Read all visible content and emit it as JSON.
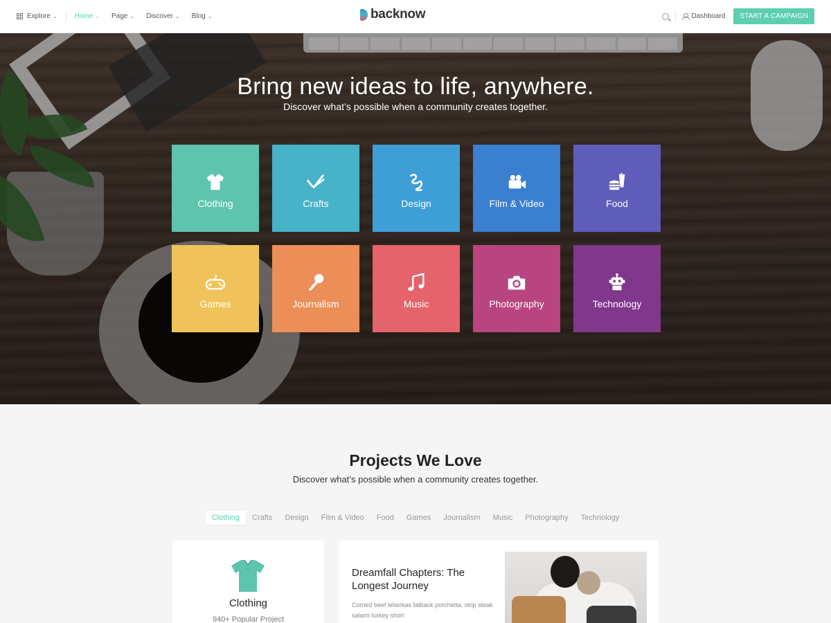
{
  "header": {
    "nav": [
      {
        "label": "Explore",
        "active": false
      },
      {
        "label": "Home",
        "active": true
      },
      {
        "label": "Page",
        "active": false
      },
      {
        "label": "Discover",
        "active": false
      },
      {
        "label": "Blog",
        "active": false
      }
    ],
    "logo_text": "backnow",
    "dashboard_label": "Dashboard",
    "cta_label": "START A CAMPAIGN"
  },
  "hero": {
    "title": "Bring new ideas to life, anywhere.",
    "subtitle": "Discover what’s possible when a community creates together.",
    "categories": [
      {
        "label": "Clothing",
        "icon": "shirt-icon",
        "color": "#5fc4ad"
      },
      {
        "label": "Crafts",
        "icon": "crafts-icon",
        "color": "#46b3c8"
      },
      {
        "label": "Design",
        "icon": "design-icon",
        "color": "#3e9ed6"
      },
      {
        "label": "Film & Video",
        "icon": "video-camera-icon",
        "color": "#3a7fd0"
      },
      {
        "label": "Food",
        "icon": "food-icon",
        "color": "#5e5dba"
      },
      {
        "label": "Games",
        "icon": "gamepad-icon",
        "color": "#efc35a"
      },
      {
        "label": "Journalism",
        "icon": "microphone-icon",
        "color": "#ec8e58"
      },
      {
        "label": "Music",
        "icon": "music-note-icon",
        "color": "#e5636b"
      },
      {
        "label": "Photography",
        "icon": "camera-icon",
        "color": "#b8457f"
      },
      {
        "label": "Technology",
        "icon": "robot-icon",
        "color": "#80378c"
      }
    ]
  },
  "projects": {
    "title": "Projects We Love",
    "subtitle": "Discover what’s possible when a community creates together.",
    "tabs": [
      "Clothing",
      "Crafts",
      "Design",
      "Film & Video",
      "Food",
      "Games",
      "Journalism",
      "Music",
      "Photography",
      "Technology"
    ],
    "active_tab": "Clothing",
    "category_card": {
      "title": "Clothing",
      "count": "940+ Popular Project",
      "icon": "shirt-icon",
      "color": "#5fc4ad"
    },
    "featured": {
      "title": "Dreamfall Chapters: The Longest Journey",
      "description": "Corned beef leberkas fatback porchetta, strip steak salami turkey short"
    }
  },
  "colors": {
    "accent": "#5ccfb0"
  }
}
